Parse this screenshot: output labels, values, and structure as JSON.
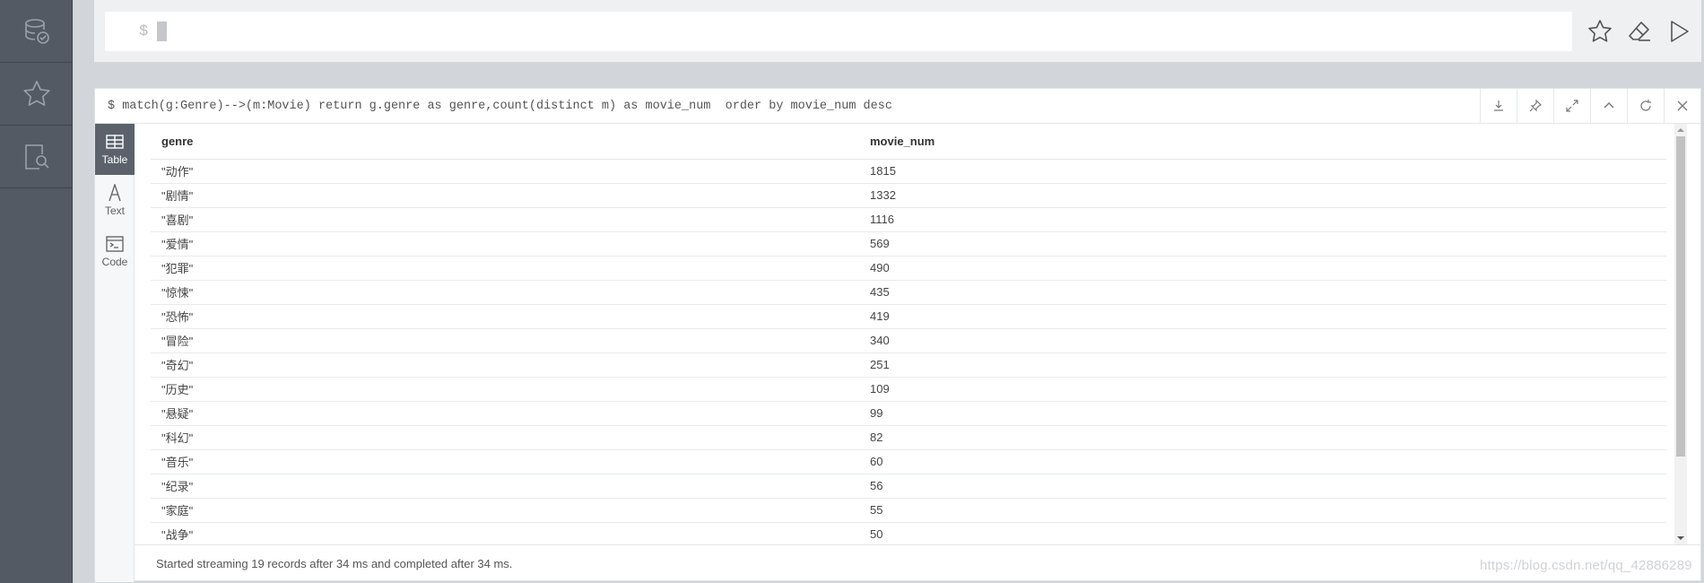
{
  "editor": {
    "prompt": "$"
  },
  "frame": {
    "query": "$ match(g:Genre)-->(m:Movie) return g.genre as genre,count(distinct m) as movie_num  order by movie_num desc"
  },
  "view_tabs": [
    {
      "label": "Table"
    },
    {
      "label": "Text"
    },
    {
      "label": "Code"
    }
  ],
  "table": {
    "columns": [
      "genre",
      "movie_num"
    ],
    "rows": [
      [
        "\"动作\"",
        "1815"
      ],
      [
        "\"剧情\"",
        "1332"
      ],
      [
        "\"喜剧\"",
        "1116"
      ],
      [
        "\"爱情\"",
        "569"
      ],
      [
        "\"犯罪\"",
        "490"
      ],
      [
        "\"惊悚\"",
        "435"
      ],
      [
        "\"恐怖\"",
        "419"
      ],
      [
        "\"冒险\"",
        "340"
      ],
      [
        "\"奇幻\"",
        "251"
      ],
      [
        "\"历史\"",
        "109"
      ],
      [
        "\"悬疑\"",
        "99"
      ],
      [
        "\"科幻\"",
        "82"
      ],
      [
        "\"音乐\"",
        "60"
      ],
      [
        "\"纪录\"",
        "56"
      ],
      [
        "\"家庭\"",
        "55"
      ],
      [
        "\"战争\"",
        "50"
      ]
    ]
  },
  "status": "Started streaming 19 records after 34 ms and completed after 34 ms.",
  "watermark": "https://blog.csdn.net/qq_42886289"
}
